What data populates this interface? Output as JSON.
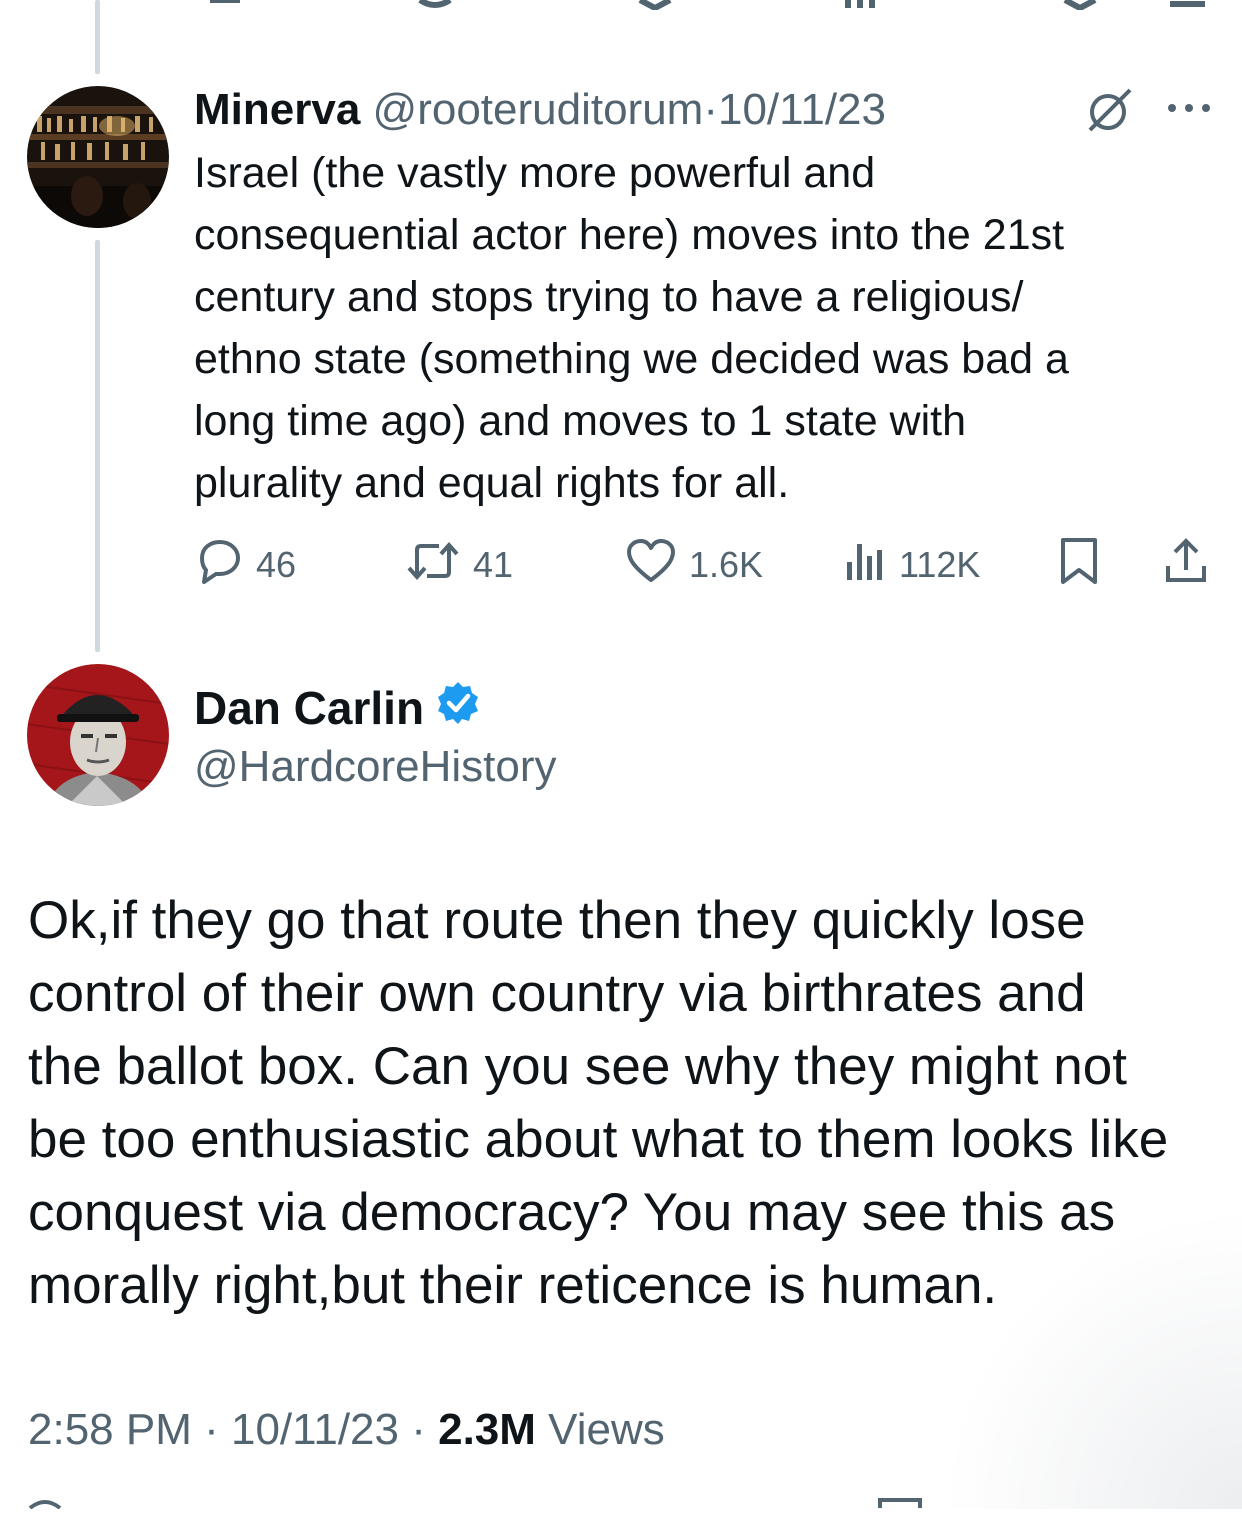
{
  "parent_tweet": {
    "name": "Minerva",
    "handle": "@rooteruditorum",
    "separator": "·",
    "date": "10/11/23",
    "text": "Israel (the vastly more powerful and\nconsequential actor here) moves into the 21st\ncentury and stops trying to have a religious/\nethno state (something we decided was bad a\nlong time ago) and moves to 1 state with\nplurality and equal rights for all.",
    "stats": {
      "replies": "46",
      "reposts": "41",
      "likes": "1.6K",
      "views": "112K"
    },
    "icons": [
      "grok-icon",
      "more-icon",
      "reply-icon",
      "repost-icon",
      "like-icon",
      "views-icon",
      "bookmark-icon",
      "share-icon"
    ]
  },
  "main_tweet": {
    "name": "Dan Carlin",
    "verified": true,
    "handle": "@HardcoreHistory",
    "text": "Ok,if they go that route then they quickly lose\ncontrol of their own country via birthrates and\nthe ballot box. Can you see why they might not\nbe too enthusiastic about what to them looks like\nconquest via democracy? You may see this as\nmorally right,but their reticence is human.",
    "time": "2:58 PM",
    "sep1": " · ",
    "date": "10/11/23",
    "sep2": " · ",
    "views_count": "2.3M",
    "views_label": " Views"
  },
  "colors": {
    "text": "#0f1419",
    "muted": "#536471",
    "thread_line": "#cfd9de",
    "verified": "#1d9bf0",
    "avatar_red": "#a4161a"
  }
}
